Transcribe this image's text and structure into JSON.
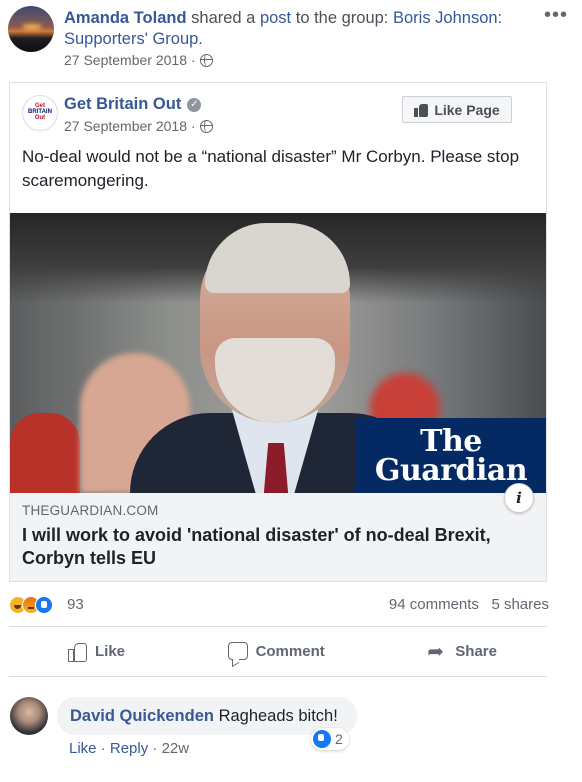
{
  "share_header": {
    "author": "Amanda Toland",
    "shared_text": "shared a",
    "post_link": "post",
    "to_text": "to the group:",
    "group_name": "Boris Johnson: Supporters' Group.",
    "date": "27 September 2018 ·",
    "more_icon": "more-dots-icon"
  },
  "page": {
    "name": "Get Britain Out",
    "avatar_lines": [
      "Get",
      "BRITAIN",
      "Out"
    ],
    "date": "27 September 2018 ·",
    "like_page_label": "Like Page",
    "post_text": "No-deal would not be a “national disaster” Mr Corbyn. Please stop scaremongering."
  },
  "link_preview": {
    "logo_line1": "The",
    "logo_line2": "Guardian",
    "info_label": "i",
    "domain": "THEGUARDIAN.COM",
    "title": "I will work to avoid 'national disaster' of no-deal Brexit, Corbyn tells EU"
  },
  "stats": {
    "reaction_count": "93",
    "comments": "94 comments",
    "shares": "5 shares",
    "reaction_icons": [
      "haha",
      "angry",
      "like"
    ]
  },
  "actions": {
    "like": "Like",
    "comment": "Comment",
    "share": "Share"
  },
  "comment": {
    "author": "David Quickenden",
    "text": "Ragheads bitch!",
    "like_label": "Like",
    "reply_label": "Reply",
    "separator1": "·",
    "separator2": "·",
    "age": "22w",
    "reaction_count": "2"
  },
  "colors": {
    "link_blue": "#365899",
    "guardian_navy": "#052962",
    "like_blue": "#1877f2"
  }
}
